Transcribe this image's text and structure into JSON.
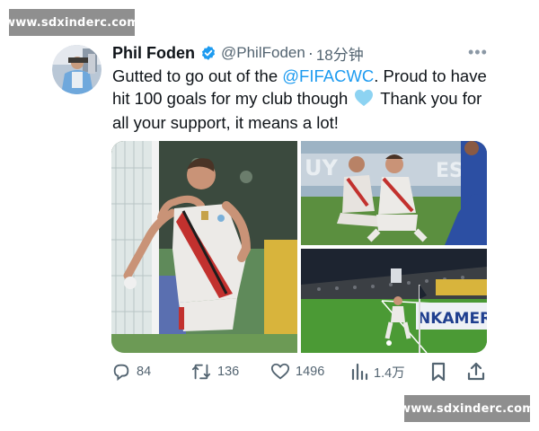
{
  "watermarks": {
    "top": "www.sdxinderc.com",
    "bottom": "www.sdxinderc.com"
  },
  "tweet": {
    "name": "Phil Foden",
    "verified": true,
    "handle": "@PhilFoden",
    "separator": "·",
    "time": "18分钟",
    "more_label": "•••",
    "text_parts": {
      "part1": "Gutted to go out of the ",
      "mention": "@FIFACWC",
      "part2": ". Proud to have hit 100 goals for my club though ",
      "emoji": "light-blue-heart-icon",
      "part3": " Thank you for all your support, it means a lot!"
    },
    "media": [
      {
        "description_icon": "player-celebrating-photo"
      },
      {
        "description_icon": "players-sitting-on-pitch-photo"
      },
      {
        "description_icon": "player-taking-corner-photo"
      }
    ],
    "ad_board_text": "NKAMERI",
    "stats": {
      "replies": "84",
      "retweets": "136",
      "likes": "1496",
      "views": "1.4万"
    }
  },
  "colors": {
    "accent": "#1d9bf0",
    "verified": "#1d9bf0",
    "secondary_text": "#536471",
    "watermark_bg": "#8f8f8f"
  }
}
